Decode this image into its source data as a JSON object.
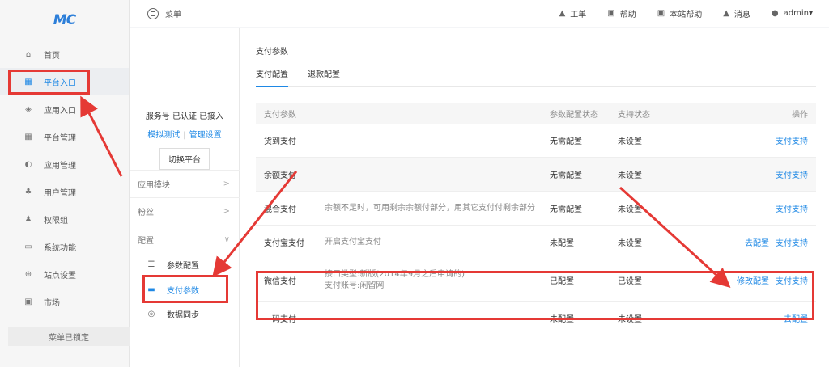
{
  "logo": "MC",
  "sidebar": {
    "items": [
      {
        "label": "首页",
        "icon": "home-icon"
      },
      {
        "label": "平台入口",
        "icon": "grid-icon",
        "active": true
      },
      {
        "label": "应用入口",
        "icon": "cube-icon"
      },
      {
        "label": "平台管理",
        "icon": "apps-icon"
      },
      {
        "label": "应用管理",
        "icon": "app-manage-icon"
      },
      {
        "label": "用户管理",
        "icon": "users-icon"
      },
      {
        "label": "权限组",
        "icon": "permission-icon"
      },
      {
        "label": "系统功能",
        "icon": "monitor-icon"
      },
      {
        "label": "站点设置",
        "icon": "globe-icon"
      },
      {
        "label": "市场",
        "icon": "market-icon"
      }
    ],
    "lock_label": "菜单已锁定"
  },
  "topbar": {
    "menu_label": "菜单",
    "links": [
      {
        "label": "工单",
        "icon": "bell-icon"
      },
      {
        "label": "帮助",
        "icon": "help-icon"
      },
      {
        "label": "本站帮助",
        "icon": "site-help-icon"
      },
      {
        "label": "消息",
        "icon": "message-icon"
      }
    ],
    "user": "admin▾"
  },
  "subsidebar": {
    "service_status": "服务号 已认证 已接入",
    "test_link": "模拟测试",
    "separator": "|",
    "manage_link": "管理设置",
    "switch_button": "切换平台",
    "groups": [
      "应用模块",
      "粉丝",
      "配置"
    ],
    "items": [
      {
        "label": "参数配置",
        "icon": "list-icon"
      },
      {
        "label": "支付参数",
        "icon": "wallet-icon",
        "active": true
      },
      {
        "label": "数据同步",
        "icon": "sync-icon"
      }
    ]
  },
  "main": {
    "title": "支付参数",
    "tabs": [
      "支付配置",
      "退款配置"
    ],
    "headers": [
      "支付参数",
      "参数配置状态",
      "支持状态",
      "操作"
    ],
    "rows": [
      {
        "name": "货到支付",
        "desc": "",
        "desc2": "",
        "config": "无需配置",
        "support": "未设置",
        "actions": [
          "支付支持"
        ]
      },
      {
        "name": "余额支付",
        "desc": "",
        "desc2": "",
        "config": "无需配置",
        "support": "未设置",
        "actions": [
          "支付支持"
        ]
      },
      {
        "name": "混合支付",
        "desc": "余额不足时，可用剩余余额付部分，用其它支付付剩余部分",
        "desc2": "",
        "config": "无需配置",
        "support": "未设置",
        "actions": [
          "支付支持"
        ]
      },
      {
        "name": "支付宝支付",
        "desc": "开启支付宝支付",
        "desc2": "",
        "config": "未配置",
        "support": "未设置",
        "actions": [
          "去配置",
          "支付支持"
        ]
      },
      {
        "name": "微信支付",
        "desc": "接口类型:新版(2014年9月之后申请的)",
        "desc2": "支付账号:闲留网",
        "config": "已配置",
        "support": "已设置",
        "actions": [
          "修改配置",
          "支付支持"
        ]
      },
      {
        "name": "一码支付",
        "desc": "",
        "desc2": "",
        "config": "未配置",
        "support": "未设置",
        "actions": [
          "去配置"
        ]
      }
    ]
  },
  "colors": {
    "accent": "#1e88e5",
    "annotation": "#e53935"
  }
}
